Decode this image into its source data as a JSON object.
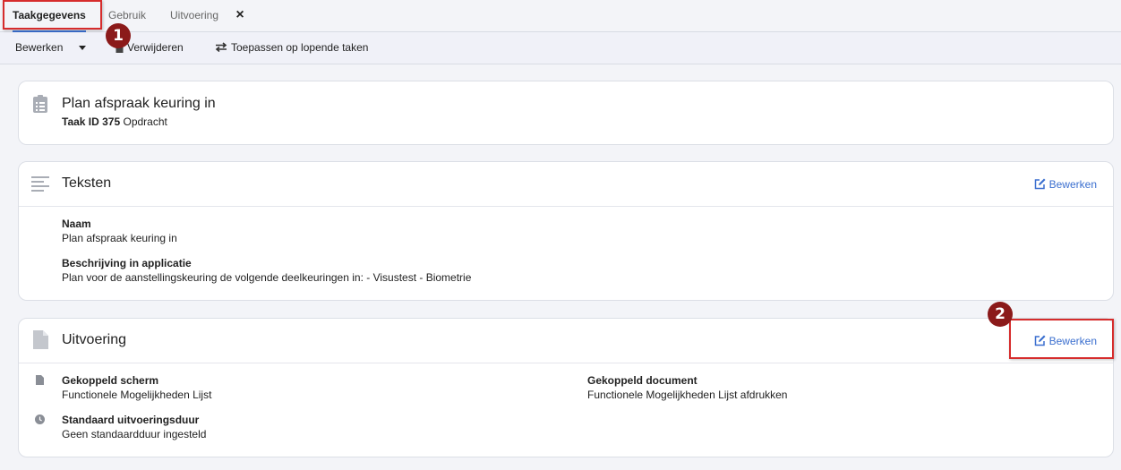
{
  "tabs": [
    {
      "label": "Taakgegevens",
      "active": true
    },
    {
      "label": "Gebruik",
      "active": false
    },
    {
      "label": "Uitvoering",
      "active": false
    }
  ],
  "toolbar": {
    "edit_label": "Bewerken",
    "delete_label": "Verwijderen",
    "apply_label": "Toepassen op lopende taken"
  },
  "header_card": {
    "title": "Plan afspraak keuring in",
    "id_label": "Taak ID 375",
    "type": "Opdracht"
  },
  "texts_card": {
    "title": "Teksten",
    "edit_label": "Bewerken",
    "fields": [
      {
        "label": "Naam",
        "value": "Plan afspraak keuring in"
      },
      {
        "label": "Beschrijving in applicatie",
        "value": "Plan voor de aanstellingskeuring de volgende deelkeuringen in: - Visustest - Biometrie"
      }
    ]
  },
  "execution_card": {
    "title": "Uitvoering",
    "edit_label": "Bewerken",
    "screen": {
      "label": "Gekoppeld scherm",
      "value": "Functionele Mogelijkheden Lijst"
    },
    "document": {
      "label": "Gekoppeld document",
      "value": "Functionele Mogelijkheden Lijst afdrukken"
    },
    "duration": {
      "label": "Standaard uitvoeringsduur",
      "value": "Geen standaardduur ingesteld"
    }
  },
  "annotations": {
    "marker_1": "1",
    "marker_2": "2"
  },
  "colors": {
    "accent": "#3b6fcf",
    "marker": "#8b1a1a",
    "highlight": "#d62c2c"
  },
  "icons": [
    "close-icon",
    "trash-icon",
    "swap-icon",
    "clipboard-list-icon",
    "text-lines-icon",
    "file-icon",
    "edit-icon",
    "clock-icon"
  ]
}
